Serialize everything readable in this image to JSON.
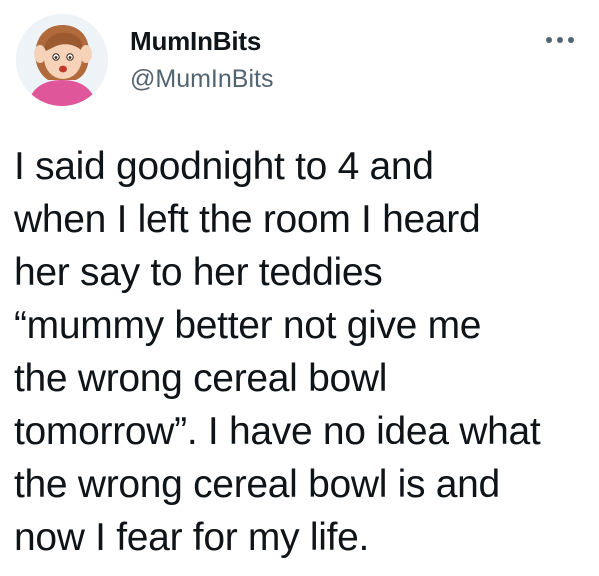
{
  "tweet": {
    "author": {
      "display_name": "MumInBits",
      "handle": "@MumInBits",
      "avatar_icon": "cartoon-mum-avatar"
    },
    "more_icon": "more-horizontal-icon",
    "text": "I said goodnight to 4 and\nwhen I left the room I heard\nher say to her teddies\n“mummy better not give me\nthe wrong cereal bowl\ntomorrow”. I have no idea what\nthe wrong cereal bowl is and\nnow I fear for my life."
  },
  "colors": {
    "text_primary": "#0f1419",
    "text_secondary": "#536471",
    "avatar_shirt": "#e0569a",
    "avatar_hair": "#b06a3c"
  }
}
